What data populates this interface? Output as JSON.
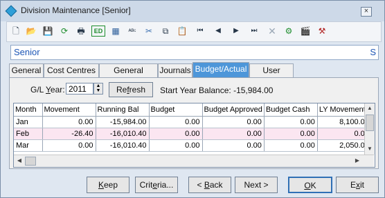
{
  "window": {
    "title": "Division Maintenance  [Senior]",
    "close_symbol": "×"
  },
  "toolbar": {
    "icons": [
      {
        "name": "new-document-icon",
        "glyph": "🗋"
      },
      {
        "name": "open-folder-icon",
        "glyph": "📂"
      },
      {
        "name": "save-icon",
        "glyph": "💾"
      },
      {
        "name": "refresh-icon",
        "glyph": "⟳"
      },
      {
        "name": "print-icon",
        "glyph": "🖶"
      },
      {
        "name": "edit-icon",
        "glyph": "ED"
      },
      {
        "name": "calculator-icon",
        "glyph": "▦"
      },
      {
        "name": "spell-check-icon",
        "glyph": "ᴬᴮᶜ"
      },
      {
        "name": "cut-icon",
        "glyph": "✂"
      },
      {
        "name": "copy-icon",
        "glyph": "⧉"
      },
      {
        "name": "paste-icon",
        "glyph": "📋"
      },
      {
        "name": "first-record-icon",
        "glyph": "⏮"
      },
      {
        "name": "previous-record-icon",
        "glyph": "◀"
      },
      {
        "name": "next-record-icon",
        "glyph": "▶"
      },
      {
        "name": "last-record-icon",
        "glyph": "⏭"
      },
      {
        "name": "delete-icon",
        "glyph": "✕"
      },
      {
        "name": "filter-icon",
        "glyph": "⚙"
      },
      {
        "name": "clapper-icon",
        "glyph": "🎬"
      },
      {
        "name": "tools-icon",
        "glyph": "⚒"
      }
    ]
  },
  "record": {
    "name": "Senior",
    "code": "S"
  },
  "tabs": [
    "General",
    "Cost Centres",
    "General Ledger",
    "Journals",
    "Budget/Actual",
    "User Forms"
  ],
  "controls": {
    "gl_year_prefix": "G/L ",
    "gl_year_underlined": "Y",
    "gl_year_suffix": "ear:",
    "year_value": "2011",
    "refresh_prefix": "Re",
    "refresh_underlined": "f",
    "refresh_suffix": "resh",
    "start_balance": "Start Year Balance:  -15,984.00"
  },
  "table": {
    "columns": [
      "Month",
      "Movement",
      "Running Bal",
      "Budget",
      "Budget Approved",
      "Budget Cash",
      "LY Movement"
    ],
    "rows": [
      [
        "Jan",
        "0.00",
        "-15,984.00",
        "0.00",
        "0.00",
        "0.00",
        "8,100.0"
      ],
      [
        "Feb",
        "-26.40",
        "-16,010.40",
        "0.00",
        "0.00",
        "0.00",
        "0.0"
      ],
      [
        "Mar",
        "0.00",
        "-16,010.40",
        "0.00",
        "0.00",
        "0.00",
        "2,050.0"
      ]
    ]
  },
  "buttons": {
    "keep": {
      "pre": "",
      "ul": "K",
      "post": "eep"
    },
    "criteria": {
      "pre": "Crit",
      "ul": "e",
      "post": "ria..."
    },
    "back": {
      "pre": "< ",
      "ul": "B",
      "post": "ack"
    },
    "next": {
      "pre": "Next >",
      "ul": "",
      "post": ""
    },
    "ok": {
      "pre": "",
      "ul": "O",
      "post": "K"
    },
    "exit": {
      "pre": "E",
      "ul": "x",
      "post": "it"
    }
  }
}
